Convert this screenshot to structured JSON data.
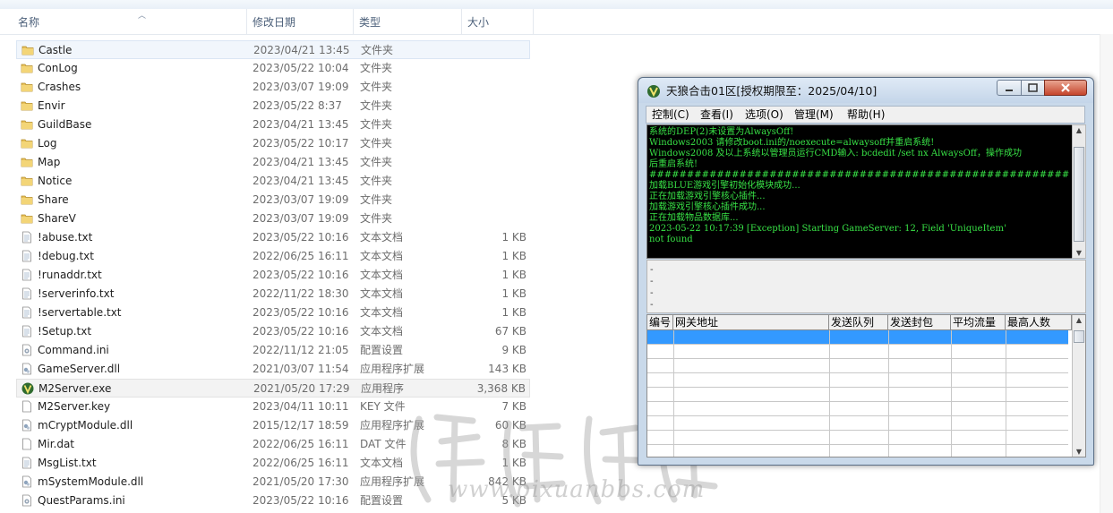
{
  "explorer": {
    "columns": {
      "name": "名称",
      "modified": "修改日期",
      "type": "类型",
      "size": "大小"
    },
    "files": [
      {
        "name": "Castle",
        "modified": "2023/04/21 13:45",
        "type": "文件夹",
        "size": "",
        "icon": "folder-icon"
      },
      {
        "name": "ConLog",
        "modified": "2023/05/22 10:04",
        "type": "文件夹",
        "size": "",
        "icon": "folder-icon"
      },
      {
        "name": "Crashes",
        "modified": "2023/03/07 19:09",
        "type": "文件夹",
        "size": "",
        "icon": "folder-icon"
      },
      {
        "name": "Envir",
        "modified": "2023/05/22 8:37",
        "type": "文件夹",
        "size": "",
        "icon": "folder-icon"
      },
      {
        "name": "GuildBase",
        "modified": "2023/04/21 13:45",
        "type": "文件夹",
        "size": "",
        "icon": "folder-icon"
      },
      {
        "name": "Log",
        "modified": "2023/05/22 10:17",
        "type": "文件夹",
        "size": "",
        "icon": "folder-icon"
      },
      {
        "name": "Map",
        "modified": "2023/04/21 13:45",
        "type": "文件夹",
        "size": "",
        "icon": "folder-icon"
      },
      {
        "name": "Notice",
        "modified": "2023/04/21 13:45",
        "type": "文件夹",
        "size": "",
        "icon": "folder-icon"
      },
      {
        "name": "Share",
        "modified": "2023/03/07 19:09",
        "type": "文件夹",
        "size": "",
        "icon": "folder-icon"
      },
      {
        "name": "ShareV",
        "modified": "2023/03/07 19:09",
        "type": "文件夹",
        "size": "",
        "icon": "folder-icon"
      },
      {
        "name": "!abuse.txt",
        "modified": "2023/05/22 10:16",
        "type": "文本文档",
        "size": "1 KB",
        "icon": "text-file-icon"
      },
      {
        "name": "!debug.txt",
        "modified": "2022/06/25 16:11",
        "type": "文本文档",
        "size": "1 KB",
        "icon": "text-file-icon"
      },
      {
        "name": "!runaddr.txt",
        "modified": "2023/05/22 10:16",
        "type": "文本文档",
        "size": "1 KB",
        "icon": "text-file-icon"
      },
      {
        "name": "!serverinfo.txt",
        "modified": "2022/11/22 18:30",
        "type": "文本文档",
        "size": "1 KB",
        "icon": "text-file-icon"
      },
      {
        "name": "!servertable.txt",
        "modified": "2023/05/22 10:16",
        "type": "文本文档",
        "size": "1 KB",
        "icon": "text-file-icon"
      },
      {
        "name": "!Setup.txt",
        "modified": "2023/05/22 10:16",
        "type": "文本文档",
        "size": "67 KB",
        "icon": "text-file-icon"
      },
      {
        "name": "Command.ini",
        "modified": "2022/11/12 21:05",
        "type": "配置设置",
        "size": "9 KB",
        "icon": "config-file-icon"
      },
      {
        "name": "GameServer.dll",
        "modified": "2021/03/07 11:54",
        "type": "应用程序扩展",
        "size": "143 KB",
        "icon": "dll-file-icon"
      },
      {
        "name": "M2Server.exe",
        "modified": "2021/05/20 17:29",
        "type": "应用程序",
        "size": "3,368 KB",
        "icon": "m2server-app-icon"
      },
      {
        "name": "M2Server.key",
        "modified": "2023/04/11 10:11",
        "type": "KEY 文件",
        "size": "7 KB",
        "icon": "blank-file-icon"
      },
      {
        "name": "mCryptModule.dll",
        "modified": "2015/12/17 18:59",
        "type": "应用程序扩展",
        "size": "60 KB",
        "icon": "dll-file-icon"
      },
      {
        "name": "Mir.dat",
        "modified": "2022/06/25 16:11",
        "type": "DAT 文件",
        "size": "8 KB",
        "icon": "blank-file-icon"
      },
      {
        "name": "MsgList.txt",
        "modified": "2022/06/25 16:11",
        "type": "文本文档",
        "size": "1 KB",
        "icon": "text-file-icon"
      },
      {
        "name": "mSystemModule.dll",
        "modified": "2021/05/20 17:30",
        "type": "应用程序扩展",
        "size": "842 KB",
        "icon": "dll-file-icon"
      },
      {
        "name": "QuestParams.ini",
        "modified": "2023/05/22 10:16",
        "type": "配置设置",
        "size": "5 KB",
        "icon": "config-file-icon"
      }
    ]
  },
  "app_window": {
    "title": "天狼合击01区[授权期限至：2025/04/10]",
    "menu": [
      "控制(C)",
      "查看(I)",
      "选项(O)",
      "管理(M)",
      "帮助(H)"
    ],
    "console_lines": [
      "系统的DEP(2)未设置为AlwaysOff!",
      "Windows2003 请修改boot.ini的/noexecute=alwaysoff并重启系统!",
      "Windows2008 及以上系统以管理员运行CMD输入: bcdedit /set nx AlwaysOff，操作成功",
      "后重启系统!",
      "############################################################################",
      "加载BLUE游戏引擎初始化模块成功...",
      "正在加载游戏引擎核心插件...",
      "加载游戏引擎核心插件成功...",
      "正在加载物品数据库...",
      "2023-05-22 10:17:39 [Exception] Starting GameServer: 12, Field 'UniqueItem'",
      "not found"
    ],
    "log_dashes": [
      "-",
      "-",
      "-",
      "-"
    ],
    "grid_columns": [
      "编号",
      "网关地址",
      "发送队列",
      "发送封包",
      "平均流量",
      "最高人数"
    ]
  },
  "watermark": {
    "url": "www.bixuanbbs.com"
  },
  "colors": {
    "console_text": "#38e246",
    "selection_blue": "#3399ff",
    "close_button": "#c5452c"
  }
}
